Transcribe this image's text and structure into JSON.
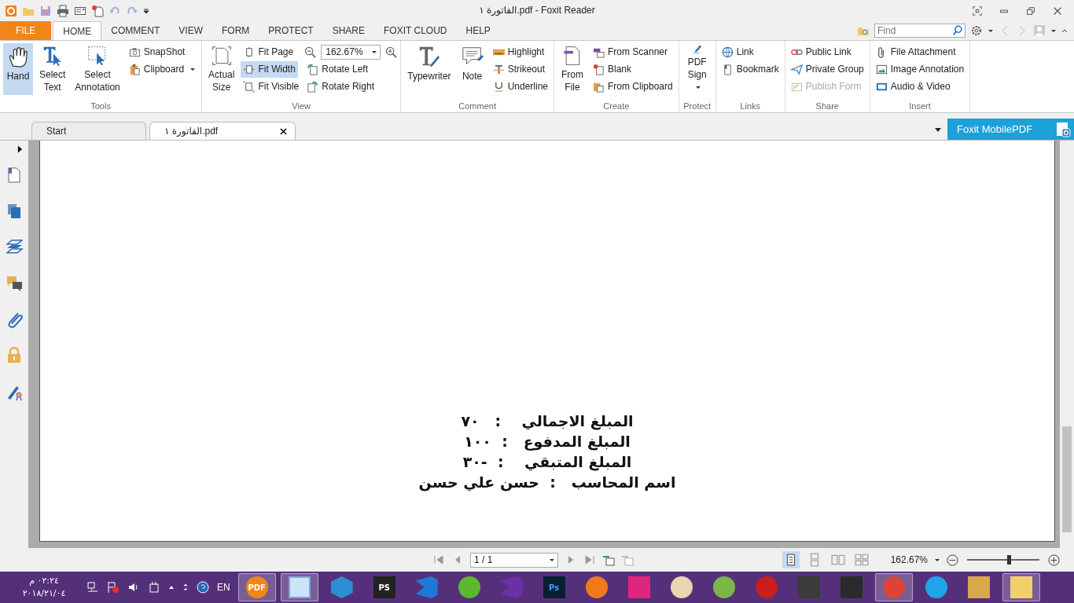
{
  "window": {
    "title": "الفاتورة ١.pdf - Foxit Reader"
  },
  "menu_tabs": [
    {
      "label": "FILE",
      "kind": "file",
      "selected": false
    },
    {
      "label": "HOME",
      "kind": "tab",
      "selected": true
    },
    {
      "label": "COMMENT",
      "kind": "tab",
      "selected": false
    },
    {
      "label": "VIEW",
      "kind": "tab",
      "selected": false
    },
    {
      "label": "FORM",
      "kind": "tab",
      "selected": false
    },
    {
      "label": "PROTECT",
      "kind": "tab",
      "selected": false
    },
    {
      "label": "SHARE",
      "kind": "tab",
      "selected": false
    },
    {
      "label": "FOXIT CLOUD",
      "kind": "tab",
      "selected": false
    },
    {
      "label": "HELP",
      "kind": "tab",
      "selected": false
    }
  ],
  "find": {
    "placeholder": "Find"
  },
  "ribbon": [
    {
      "label": "Tools",
      "items": [
        {
          "label": "Hand",
          "kind": "large",
          "selected": true,
          "disabled": false,
          "dropdown": false
        },
        {
          "label": "Select Text",
          "kind": "large",
          "selected": false,
          "disabled": false,
          "dropdown": false
        },
        {
          "label": "Select Annotation",
          "kind": "large",
          "selected": false,
          "disabled": false,
          "dropdown": false
        },
        {
          "label": "SnapShot",
          "kind": "small",
          "selected": false,
          "disabled": false,
          "dropdown": false
        },
        {
          "label": "Clipboard",
          "kind": "small",
          "selected": false,
          "disabled": false,
          "dropdown": true
        }
      ]
    },
    {
      "label": "View",
      "items": [
        {
          "label": "Actual Size",
          "kind": "large",
          "selected": false,
          "disabled": false,
          "dropdown": false
        },
        {
          "label": "Fit Page",
          "kind": "small",
          "selected": false,
          "disabled": false,
          "dropdown": false
        },
        {
          "label": "Fit Width",
          "kind": "small",
          "selected": true,
          "disabled": false,
          "dropdown": false
        },
        {
          "label": "Fit Visible",
          "kind": "small",
          "selected": false,
          "disabled": false,
          "dropdown": false
        },
        {
          "value": "162.67%",
          "kind": "zoom",
          "selected": false,
          "disabled": false,
          "dropdown": true
        },
        {
          "label": "Rotate Left",
          "kind": "small",
          "selected": false,
          "disabled": false,
          "dropdown": false
        },
        {
          "label": "Rotate Right",
          "kind": "small",
          "selected": false,
          "disabled": false,
          "dropdown": false
        }
      ]
    },
    {
      "label": "Comment",
      "items": [
        {
          "label": "Typewriter",
          "kind": "large",
          "selected": false,
          "disabled": false,
          "dropdown": false
        },
        {
          "label": "Note",
          "kind": "large",
          "selected": false,
          "disabled": false,
          "dropdown": false
        },
        {
          "label": "Highlight",
          "kind": "small",
          "selected": false,
          "disabled": false,
          "dropdown": false
        },
        {
          "label": "Strikeout",
          "kind": "small",
          "selected": false,
          "disabled": false,
          "dropdown": false
        },
        {
          "label": "Underline",
          "kind": "small",
          "selected": false,
          "disabled": false,
          "dropdown": false
        }
      ]
    },
    {
      "label": "Create",
      "items": [
        {
          "label": "From File",
          "kind": "large",
          "selected": false,
          "disabled": false,
          "dropdown": false
        },
        {
          "label": "From Scanner",
          "kind": "small",
          "selected": false,
          "disabled": false,
          "dropdown": false
        },
        {
          "label": "Blank",
          "kind": "small",
          "selected": false,
          "disabled": false,
          "dropdown": false
        },
        {
          "label": "From Clipboard",
          "kind": "small",
          "selected": false,
          "disabled": false,
          "dropdown": false
        }
      ]
    },
    {
      "label": "Protect",
      "items": [
        {
          "label": "PDF Sign",
          "kind": "large",
          "selected": false,
          "disabled": false,
          "dropdown": true
        }
      ]
    },
    {
      "label": "Links",
      "items": [
        {
          "label": "Link",
          "kind": "small",
          "selected": false,
          "disabled": false,
          "dropdown": false
        },
        {
          "label": "Bookmark",
          "kind": "small",
          "selected": false,
          "disabled": false,
          "dropdown": false
        }
      ]
    },
    {
      "label": "Share",
      "items": [
        {
          "label": "Public Link",
          "kind": "small",
          "selected": false,
          "disabled": false,
          "dropdown": false
        },
        {
          "label": "Private Group",
          "kind": "small",
          "selected": false,
          "disabled": false,
          "dropdown": false
        },
        {
          "label": "Publish Form",
          "kind": "small",
          "selected": false,
          "disabled": true,
          "dropdown": false
        }
      ]
    },
    {
      "label": "Insert",
      "items": [
        {
          "label": "File Attachment",
          "kind": "small",
          "selected": false,
          "disabled": false,
          "dropdown": false
        },
        {
          "label": "Image Annotation",
          "kind": "small",
          "selected": false,
          "disabled": false,
          "dropdown": false
        },
        {
          "label": "Audio & Video",
          "kind": "small",
          "selected": false,
          "disabled": false,
          "dropdown": false
        }
      ]
    }
  ],
  "doc_tabs": [
    {
      "label": "Start",
      "selected": false,
      "closable": false
    },
    {
      "label": "الفاتورة ١.pdf",
      "selected": true,
      "closable": true
    }
  ],
  "mobile_button": {
    "label": "Foxit MobilePDF"
  },
  "page_lines": [
    "المبلغ الاجمالي    :   ٧٠",
    "المبلغ المدفوع   :  ١٠٠",
    "المبلغ المتبقي    :  -٣٠",
    "اسم المحاسب   :  حسن علي حسن"
  ],
  "status_bar": {
    "page_field": "1 / 1",
    "zoom": "162.67%",
    "zoom_slider": {
      "level": 0.58
    }
  },
  "taskbar": {
    "time": "٠٢:٢٤ م",
    "date": "٢٠١٨/٢١/٠٤",
    "language": "EN",
    "apps": [
      {
        "label": "PDF",
        "running": true
      },
      {
        "running": true
      },
      {
        "running": false
      },
      {
        "label": "PS",
        "running": false
      },
      {
        "running": false
      },
      {
        "running": false
      },
      {
        "running": false
      },
      {
        "label": "Ps",
        "running": false
      },
      {
        "running": false
      },
      {
        "running": false
      },
      {
        "running": false
      },
      {
        "running": false
      },
      {
        "running": false
      },
      {
        "running": false
      },
      {
        "running": false
      },
      {
        "running": true
      },
      {
        "running": false
      },
      {
        "running": false
      },
      {
        "running": true
      }
    ]
  }
}
